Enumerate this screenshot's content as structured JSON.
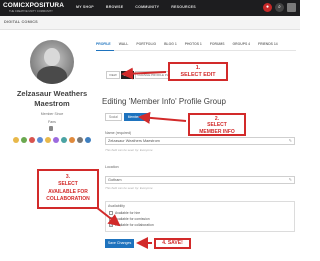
{
  "topbar": {
    "logo_main": "COMICXPOSITURA",
    "logo_sub": "THE CREATIVE UNITY COMMUNITY",
    "nav": [
      "MY SHOP",
      "BROWSE",
      "COMMUNITY",
      "RESOURCES"
    ],
    "icon_glyphs": {
      "user": "●",
      "search": "⌕",
      "avatar": " "
    }
  },
  "breadcrumb": "DIGITAL COMICS",
  "profile": {
    "name": "Zelzasaur Weathers Maestrom",
    "member_since": "Member Since",
    "fans_label": "Fans",
    "badge_colors": [
      "#e8b84a",
      "#6aa84f",
      "#d9534f",
      "#5b8bd6",
      "#e8b84a",
      "#9c6ade",
      "#4aa3a3",
      "#e08a3c",
      "#777777",
      "#3f7fbf"
    ]
  },
  "tabs": [
    "PROFILE",
    "WALL",
    "PORTFOLIO",
    "BLOG 1",
    "PHOTOS 1",
    "FORUMS",
    "GROUPS 4",
    "FRIENDS 14"
  ],
  "subnav": [
    "VIEW",
    "EDIT",
    "CHANGE PROFILE PHOTO"
  ],
  "page_heading": "Editing 'Member Info' Profile Group",
  "group_tabs": [
    "Social",
    "Member Info"
  ],
  "fields": {
    "name_label": "Name (required)",
    "name_value": "Zelzasaur Weathers Maestrom",
    "name_help": "This field can be seen by: Everyone",
    "location_label": "Location",
    "location_value": "Gotham",
    "location_help": "This field can be seen by: Everyone"
  },
  "availability": {
    "title": "Availability",
    "options": [
      {
        "label": "Available for hire",
        "checked": false
      },
      {
        "label": "Available for comission",
        "checked": false
      },
      {
        "label": "Available for collaboration",
        "checked": true
      }
    ],
    "check_glyph": "✓"
  },
  "save_label": "Save Changes",
  "annotations": {
    "a1": "1.\nSELECT EDIT",
    "a2": "2.\nSELECT\nMEMBER INFO",
    "a3": "3.\nSELECT\nAVAILABLE FOR\nCOLLABORATION",
    "a4": "4. SAVE!"
  },
  "accent_color": "#1e73be",
  "annotation_color": "#d22a2a"
}
